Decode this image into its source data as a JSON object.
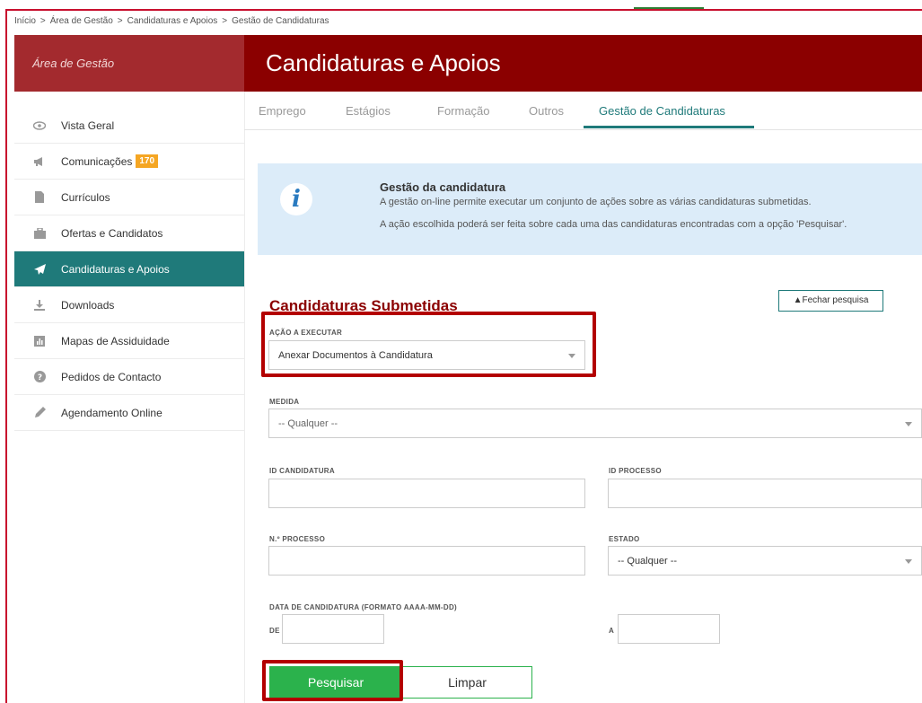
{
  "breadcrumb": [
    "Início",
    "Área de Gestão",
    "Candidaturas e Apoios",
    "Gestão de Candidaturas"
  ],
  "sidebar": {
    "title": "Área de Gestão",
    "items": [
      {
        "label": "Vista Geral",
        "icon": "eye-icon"
      },
      {
        "label": "Comunicações",
        "icon": "megaphone-icon",
        "badge": "170"
      },
      {
        "label": "Currículos",
        "icon": "file-icon"
      },
      {
        "label": "Ofertas e Candidatos",
        "icon": "briefcase-icon"
      },
      {
        "label": "Candidaturas e Apoios",
        "icon": "paper-plane-icon",
        "active": true
      },
      {
        "label": "Downloads",
        "icon": "download-icon"
      },
      {
        "label": "Mapas de Assiduidade",
        "icon": "bar-chart-icon"
      },
      {
        "label": "Pedidos de Contacto",
        "icon": "question-circle-icon"
      },
      {
        "label": "Agendamento Online",
        "icon": "pencil-icon"
      }
    ]
  },
  "header": {
    "title": "Candidaturas e Apoios"
  },
  "tabs": [
    {
      "label": "Emprego"
    },
    {
      "label": "Estágios"
    },
    {
      "label": "Formação"
    },
    {
      "label": "Outros"
    },
    {
      "label": "Gestão de Candidaturas",
      "active": true
    }
  ],
  "info": {
    "title": "Gestão da candidatura",
    "line1": "A gestão on-line permite executar um conjunto de ações sobre as várias candidaturas submetidas.",
    "line2": "A ação escolhida poderá ser feita sobre cada uma das candidaturas encontradas com a opção 'Pesquisar'."
  },
  "form": {
    "section_title": "Candidaturas Submetidas",
    "close_search": "▲Fechar pesquisa",
    "action_label": "AÇÃO A EXECUTAR",
    "action_value": "Anexar Documentos à Candidatura",
    "measure_label": "MEDIDA",
    "measure_value": "-- Qualquer --",
    "id_candidatura_label": "ID CANDIDATURA",
    "id_processo_label": "ID PROCESSO",
    "n_processo_label": "N.º PROCESSO",
    "estado_label": "ESTADO",
    "estado_value": "-- Qualquer --",
    "date_label": "DATA DE CANDIDATURA (FORMATO AAAA-MM-DD)",
    "date_from_label": "DE",
    "date_to_label": "A",
    "search_button": "Pesquisar",
    "clear_button": "Limpar"
  },
  "colors": {
    "header_bg": "#8b0000",
    "sidebar_head_bg": "#a32a2e",
    "active_teal": "#1f7a7a",
    "info_bg": "#dcecf9",
    "search_green": "#2bb24c",
    "highlight_red": "#b30000",
    "badge_orange": "#f5a623"
  }
}
